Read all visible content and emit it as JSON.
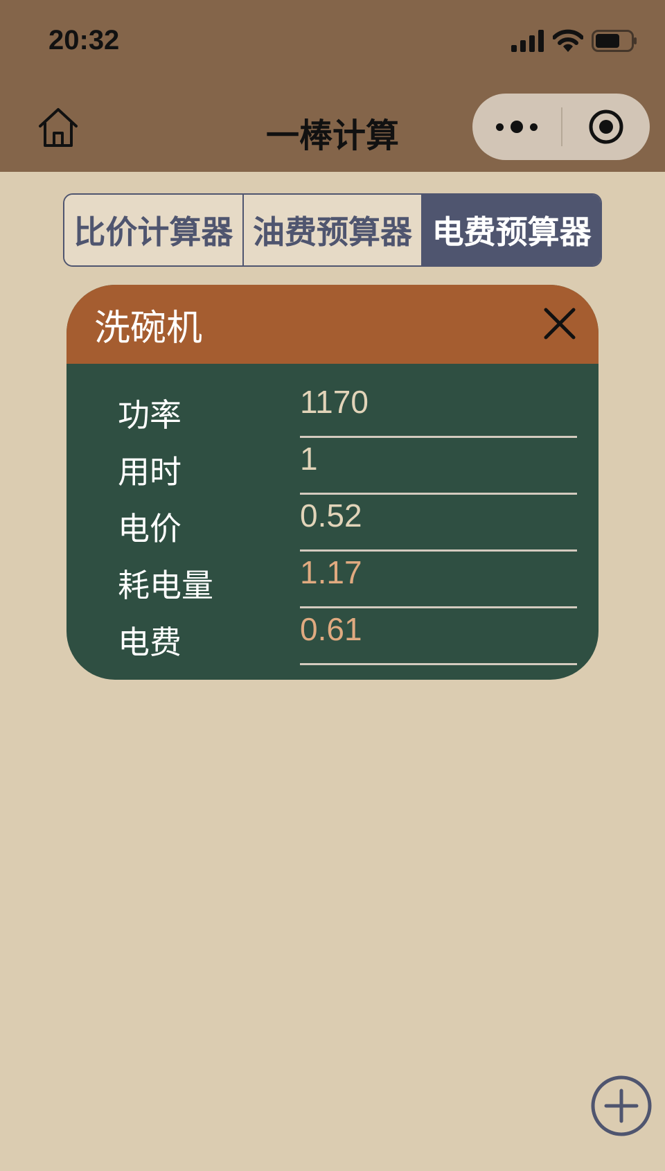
{
  "status_bar": {
    "time": "20:32"
  },
  "nav": {
    "title": "一棒计算"
  },
  "tabs": [
    {
      "label": "比价计算器",
      "active": false
    },
    {
      "label": "油费预算器",
      "active": false
    },
    {
      "label": "电费预算器",
      "active": true
    }
  ],
  "card": {
    "title": "洗碗机",
    "rows": [
      {
        "label": "功率",
        "value": "1170"
      },
      {
        "label": "用时",
        "value": "1"
      },
      {
        "label": "电价",
        "value": "0.52"
      },
      {
        "label": "耗电量",
        "value": "1.17"
      },
      {
        "label": "电费",
        "value": "0.61"
      }
    ]
  },
  "colors": {
    "header_bg": "#84654a",
    "page_bg": "#dbccb1",
    "tab_active_bg": "#4f556f",
    "card_head_bg": "#a55d30",
    "card_body_bg": "#2f4f42",
    "result_text": "#e0aa80"
  },
  "icons": [
    "home-icon",
    "more-dots-icon",
    "target-circle-icon",
    "close-icon",
    "add-circle-icon",
    "signal-icon",
    "wifi-icon",
    "battery-icon"
  ]
}
